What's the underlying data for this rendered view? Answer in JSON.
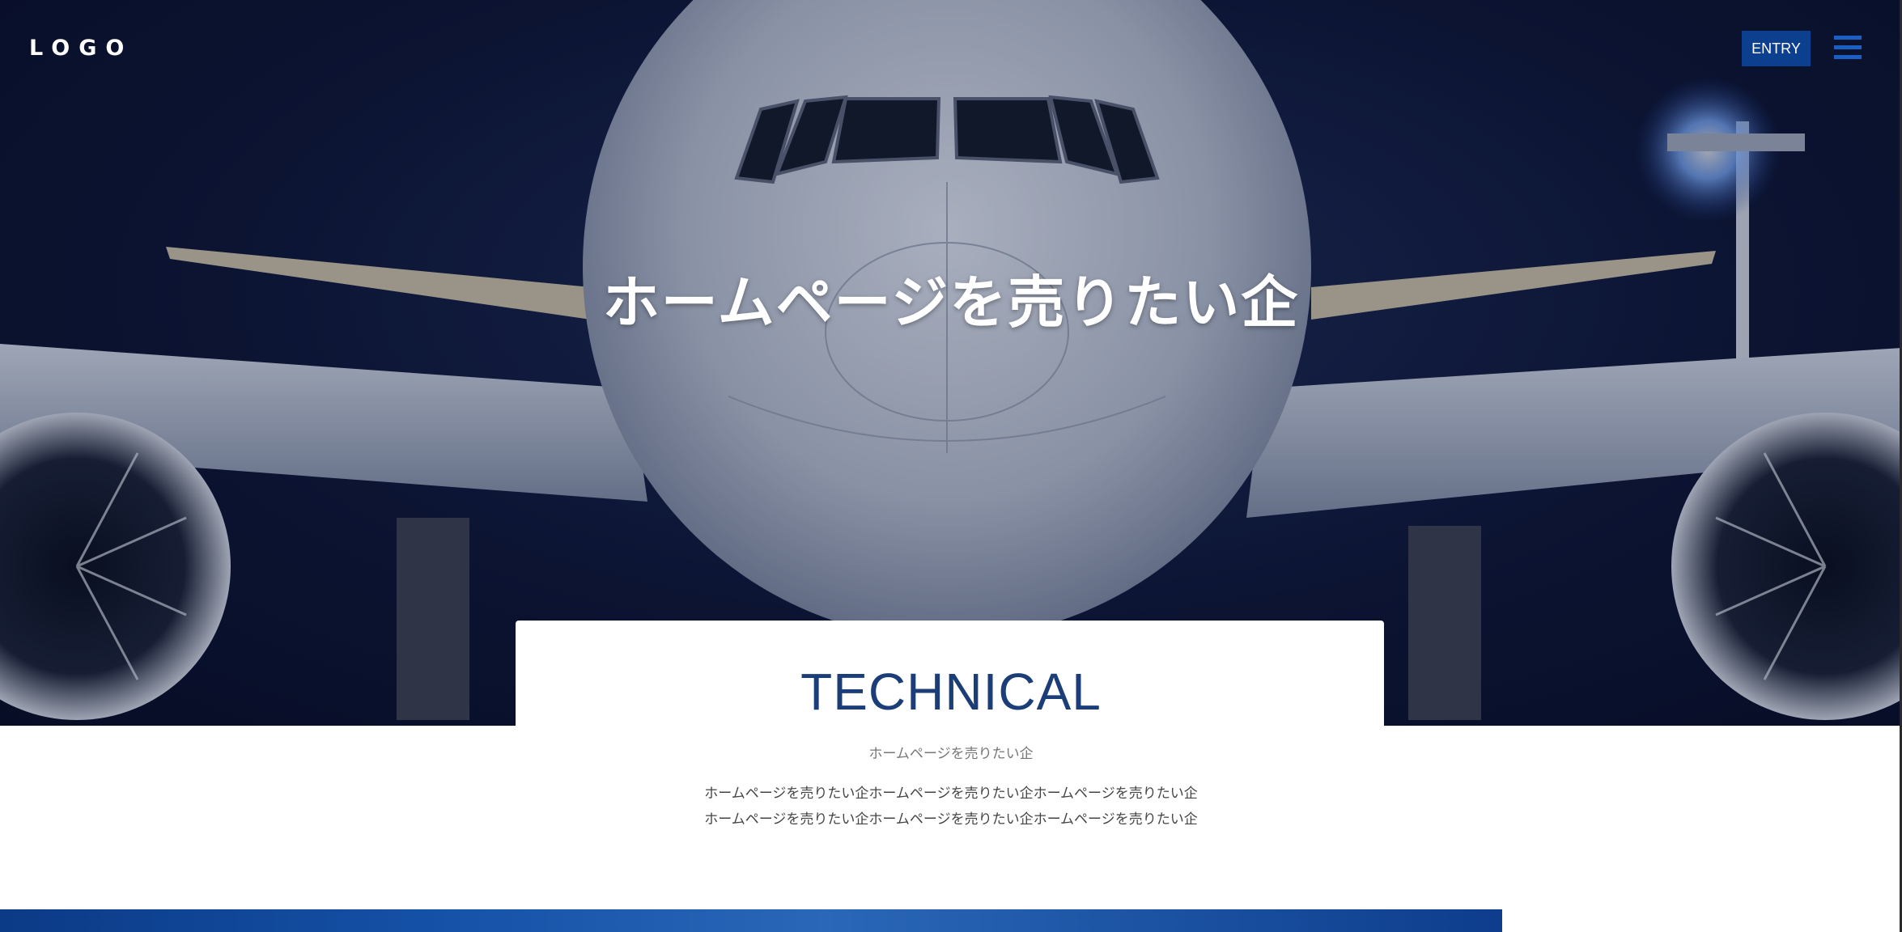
{
  "header": {
    "logo": "LOGO",
    "entry_label": "ENTRY"
  },
  "hero": {
    "title": "ホームページを売りたい企"
  },
  "section": {
    "heading": "TECHNICAL",
    "subheading": "ホームページを売りたい企",
    "body_line1": "ホームページを売りたい企ホームページを売りたい企ホームページを売りたい企",
    "body_line2": "ホームページを売りたい企ホームページを売りたい企ホームページを売りたい企"
  },
  "colors": {
    "accent_blue": "#0d3f8f",
    "heading_navy": "#1c3e78",
    "hero_background": "#0d1533"
  }
}
